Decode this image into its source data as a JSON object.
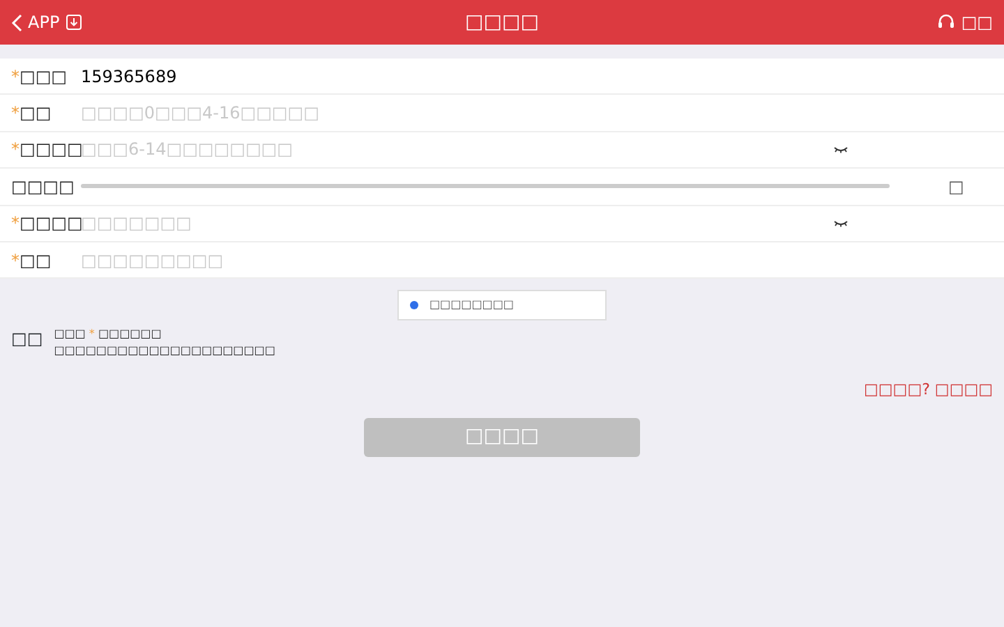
{
  "header": {
    "back_label": "APP",
    "title": "□□□□",
    "service_label": "□□"
  },
  "fields": [
    {
      "kind": "text",
      "required": true,
      "label": "□□□",
      "value": "159365689"
    },
    {
      "kind": "text",
      "required": true,
      "label": "□□",
      "placeholder": "□□□□0□□□4-16□□□□□"
    },
    {
      "kind": "password",
      "required": true,
      "label": "□□□□",
      "placeholder": "□□□6-14□□□□□□□□"
    },
    {
      "kind": "slider",
      "required": false,
      "label": "□□□□",
      "end_text": "□"
    },
    {
      "kind": "password",
      "required": true,
      "label": "□□□□",
      "placeholder": "□□□□□□□"
    },
    {
      "kind": "text",
      "required": true,
      "label": "□□",
      "placeholder": "□□□□□□□□□"
    }
  ],
  "captcha": {
    "label": "□□□□□□□□"
  },
  "note": {
    "title": "□□",
    "line_1_before": "□□□",
    "line_1_mark": "*",
    "line_1_after": "□□□□□□",
    "line_2": "□□□□□□□□□□□□□□□□□□□□□"
  },
  "link": "□□□□? □□□□",
  "submit": {
    "label": "□□□□",
    "disabled": true
  }
}
